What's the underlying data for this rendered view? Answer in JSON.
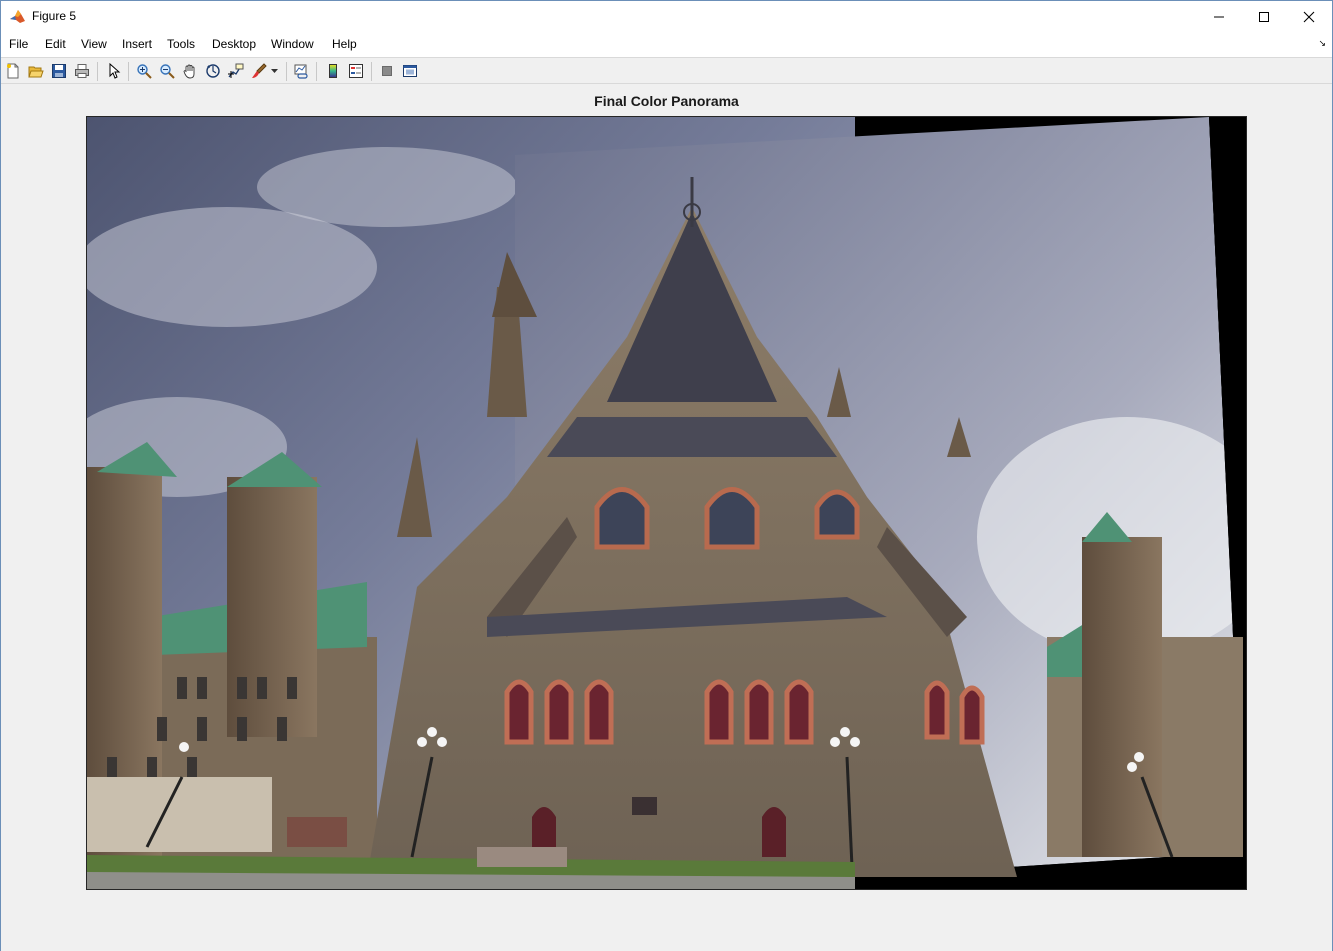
{
  "window": {
    "title": "Figure 5",
    "icon": "matlab-icon"
  },
  "menubar": {
    "items": [
      "File",
      "Edit",
      "View",
      "Insert",
      "Tools",
      "Desktop",
      "Window",
      "Help"
    ]
  },
  "toolbar": {
    "tools": [
      "new-figure-icon",
      "open-file-icon",
      "save-icon",
      "print-icon",
      "edit-plot-arrow-icon",
      "zoom-in-icon",
      "zoom-out-icon",
      "pan-hand-icon",
      "rotate-3d-icon",
      "data-cursor-icon",
      "brush-icon",
      "link-plot-icon",
      "insert-colorbar-icon",
      "insert-legend-icon",
      "hide-plot-tools-icon",
      "show-plot-tools-icon"
    ]
  },
  "axes": {
    "title": "Final Color Panorama"
  },
  "colors": {
    "background": "#f0f0f0",
    "image_border": "#000000",
    "sky": "#6f7590",
    "stone": "#8a7a66",
    "roof_green": "#4f9275"
  }
}
